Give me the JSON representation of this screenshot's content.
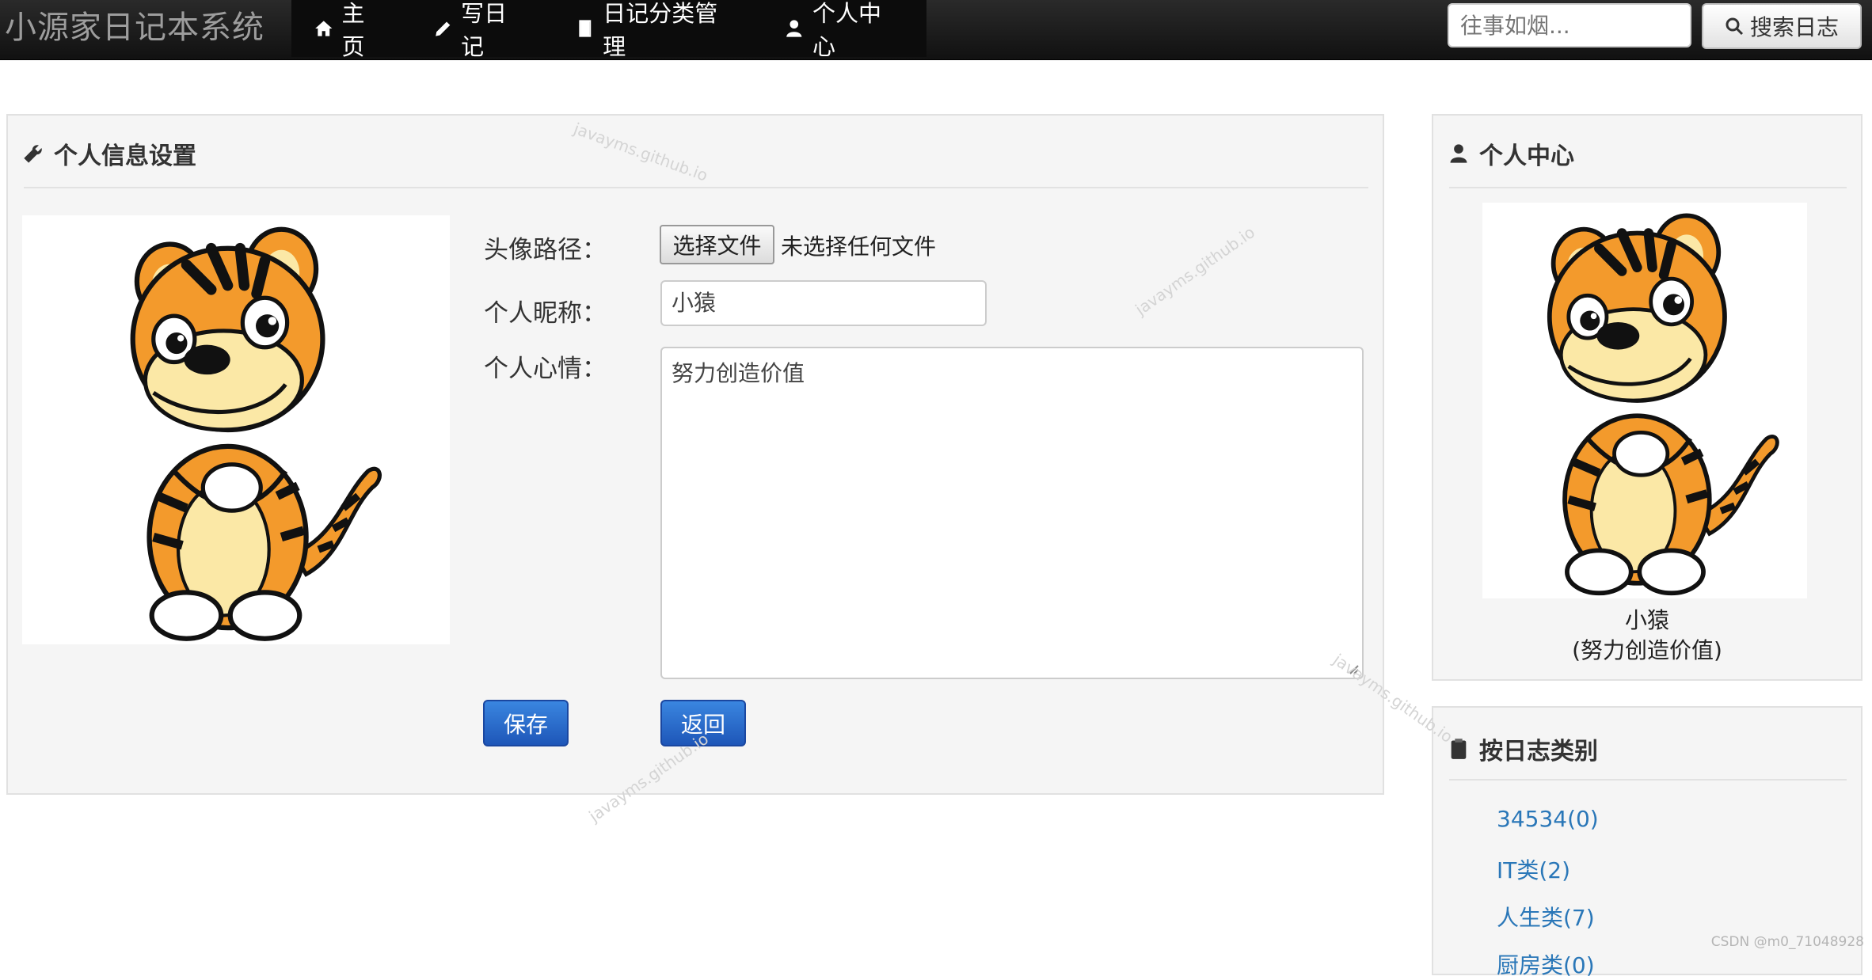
{
  "app": {
    "brand": "小源家日记本系统"
  },
  "nav": {
    "items": [
      {
        "label": "主页",
        "icon": "home-icon"
      },
      {
        "label": "写日记",
        "icon": "pencil-icon"
      },
      {
        "label": "日记分类管理",
        "icon": "book-icon"
      },
      {
        "label": "个人中心",
        "icon": "user-icon"
      }
    ]
  },
  "search": {
    "placeholder": "往事如烟...",
    "button_label": "搜索日志"
  },
  "settings": {
    "title": "个人信息设置",
    "avatar_label": "头像路径：",
    "file_button": "选择文件",
    "file_status": "未选择任何文件",
    "nickname_label": "个人昵称：",
    "nickname_value": "小猿",
    "mood_label": "个人心情：",
    "mood_value": "努力创造价值",
    "save_label": "保存",
    "back_label": "返回"
  },
  "profile": {
    "title": "个人中心",
    "name": "小猿",
    "mood": "(努力创造价值)"
  },
  "categories": {
    "title": "按日志类别",
    "items": [
      {
        "label": "34534(0)"
      },
      {
        "label": "IT类(2)"
      },
      {
        "label": "人生类(7)"
      },
      {
        "label": "厨房类(0)"
      }
    ]
  },
  "watermark": "javayms.github.io",
  "footer_mark": "CSDN @m0_71048928",
  "colors": {
    "nav_bg": "#111111",
    "primary": "#2a6fd0",
    "link": "#2a77b8",
    "panel_bg": "#f5f5f5"
  }
}
